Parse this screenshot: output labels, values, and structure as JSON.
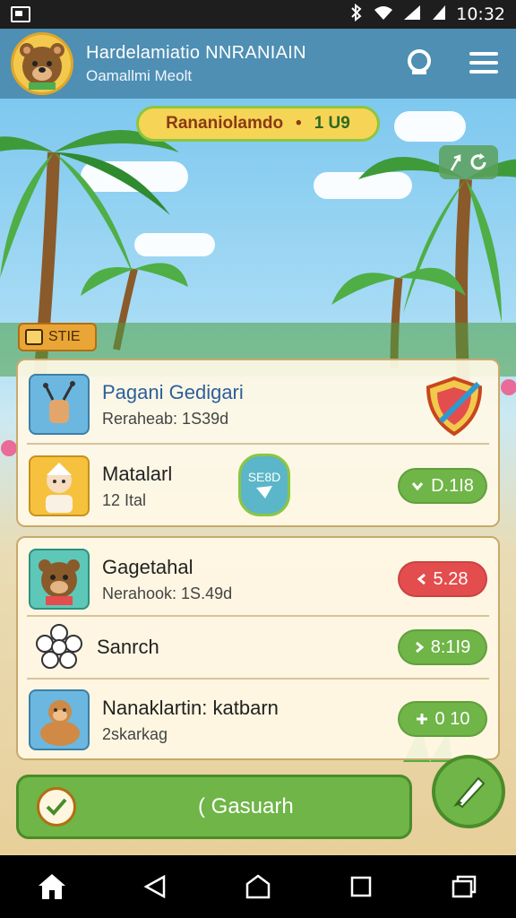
{
  "status_bar": {
    "time": "10:32",
    "icons": [
      "bluetooth-icon",
      "wifi-icon",
      "signal-icon",
      "battery-icon"
    ]
  },
  "header": {
    "title": "Hardelamiatio NNRANIAIN",
    "subtitle": "Oamallmi Meolt",
    "avatar": "bear-avatar",
    "actions": [
      "search-icon",
      "menu-icon"
    ]
  },
  "score": {
    "label": "Rananiolamdo",
    "separator": "•",
    "value": "1 U9"
  },
  "mini_button": {
    "icon": "refresh-icon"
  },
  "site_tag": {
    "label": "STIE"
  },
  "card_top": {
    "rows": [
      {
        "title": "Pagani Gedigari",
        "subtitle": "Reraheab: 1S39d",
        "icon": "hand-tool-icon",
        "badge": "shield-feather-icon",
        "title_color": "#2d5f9a"
      },
      {
        "title": "Matalarl",
        "subtitle": "12 Ital",
        "icon": "character-avatar",
        "center_badge": "SE8D",
        "pill": {
          "label": "D.1I8",
          "color": "green",
          "icon": "chevron-down-icon"
        }
      }
    ]
  },
  "card_bottom": {
    "rows": [
      {
        "title": "Gagetahal",
        "subtitle": "Nerahook: 1S.49d",
        "icon": "bear-avatar",
        "pill": {
          "label": "5.28",
          "color": "red",
          "icon": "chevron-left-icon"
        }
      },
      {
        "title": "Sanrch",
        "icon": "flower-icon",
        "pill": {
          "label": "8:1I9",
          "color": "green",
          "icon": "chevron-right-icon"
        }
      },
      {
        "title": "Nanaklartin: katbarn",
        "subtitle": "2skarkag",
        "icon": "monkey-avatar",
        "pill": {
          "label": "0 10",
          "color": "green",
          "icon": "plus-icon"
        }
      }
    ]
  },
  "bottom_bar": {
    "main_button": "( Gasuarh",
    "fab": "brush-icon"
  },
  "nav_bar": [
    "home-icon",
    "back-icon",
    "home-circle-icon",
    "recents-icon",
    "windows-icon"
  ],
  "colors": {
    "header": "#4e8fb3",
    "accent_green": "#6fb547",
    "accent_red": "#e44d4d",
    "accent_yellow": "#f6d456"
  }
}
